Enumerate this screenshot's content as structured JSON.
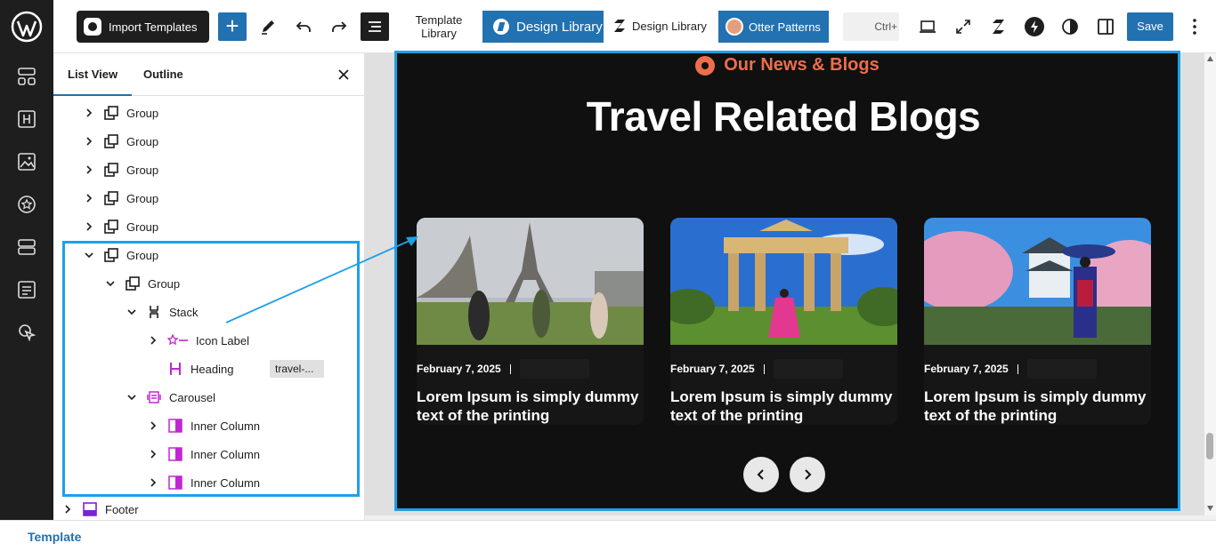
{
  "toolbar": {
    "import_templates": "Import Templates",
    "template_library": "Template Library",
    "design_library_primary": "Design Library",
    "design_library_secondary": "Design Library",
    "otter_patterns": "Otter Patterns",
    "shortcut_hint": "Ctrl+",
    "save": "Save"
  },
  "panel": {
    "tabs": [
      "List View",
      "Outline"
    ],
    "active_tab": "List View",
    "tree": [
      {
        "label": "Group",
        "depth": 0,
        "expanded": false
      },
      {
        "label": "Group",
        "depth": 0,
        "expanded": false
      },
      {
        "label": "Group",
        "depth": 0,
        "expanded": false
      },
      {
        "label": "Group",
        "depth": 0,
        "expanded": false
      },
      {
        "label": "Group",
        "depth": 0,
        "expanded": false
      },
      {
        "label": "Group",
        "depth": 0,
        "expanded": true
      },
      {
        "label": "Group",
        "depth": 1,
        "expanded": true
      },
      {
        "label": "Stack",
        "depth": 2,
        "expanded": true
      },
      {
        "label": "Icon Label",
        "depth": 3,
        "expanded": false
      },
      {
        "label": "Heading",
        "depth": 3,
        "badge": "travel-..."
      },
      {
        "label": "Carousel",
        "depth": 2,
        "expanded": true
      },
      {
        "label": "Inner Column",
        "depth": 3,
        "expanded": false
      },
      {
        "label": "Inner Column",
        "depth": 3,
        "expanded": false
      },
      {
        "label": "Inner Column",
        "depth": 3,
        "expanded": false
      },
      {
        "label": "Footer",
        "depth": -1,
        "expanded": false
      }
    ]
  },
  "preview": {
    "eyebrow": "Our News & Blogs",
    "heading": "Travel Related Blogs",
    "cards": [
      {
        "date": "February 7, 2025",
        "title": "Lorem Ipsum is simply dummy text of the printing",
        "image": "eiffel-tower-photo"
      },
      {
        "date": "February 7, 2025",
        "title": "Lorem Ipsum is simply dummy text of the printing",
        "image": "ancient-ruins-photo"
      },
      {
        "date": "February 7, 2025",
        "title": "Lorem Ipsum is simply dummy text of the printing",
        "image": "japanese-castle-photo"
      }
    ]
  },
  "footer": {
    "breadcrumb": "Template"
  },
  "colors": {
    "accent": "#2271b1",
    "highlight": "#1fa0e6",
    "eyebrow": "#ec6e4c",
    "dark_bg": "#101010"
  }
}
